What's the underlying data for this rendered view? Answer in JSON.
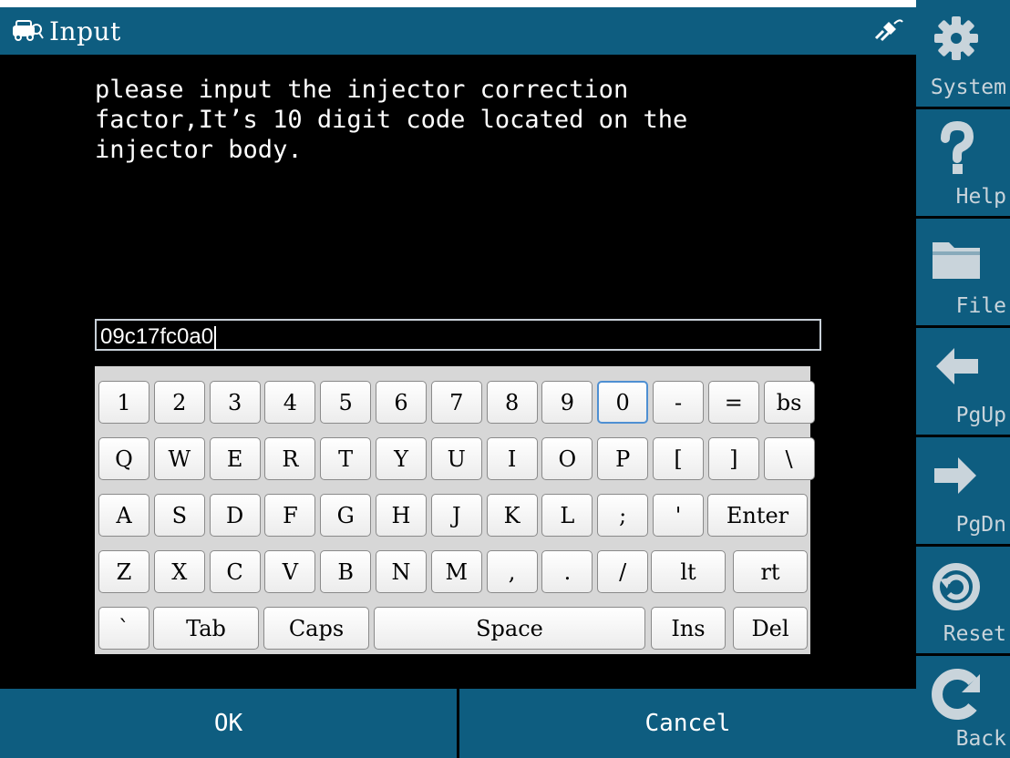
{
  "window": {
    "title": "Input",
    "car_icon": "car-icon",
    "connection_icon": "connection-icon"
  },
  "prompt": {
    "text": "please input the injector correction\nfactor,It’s 10 digit code located on the\ninjector body."
  },
  "input": {
    "value": "09c17fc0a0"
  },
  "keyboard": {
    "rows": [
      [
        "1",
        "2",
        "3",
        "4",
        "5",
        "6",
        "7",
        "8",
        "9",
        "0",
        "-",
        "=",
        "bs"
      ],
      [
        "Q",
        "W",
        "E",
        "R",
        "T",
        "Y",
        "U",
        "I",
        "O",
        "P",
        "[",
        "]",
        "\\"
      ],
      [
        "A",
        "S",
        "D",
        "F",
        "G",
        "H",
        "J",
        "K",
        "L",
        ";",
        "'",
        "Enter"
      ],
      [
        "Z",
        "X",
        "C",
        "V",
        "B",
        "N",
        "M",
        ",",
        ".",
        "/",
        "lt",
        "rt"
      ],
      [
        "`",
        "Tab",
        "Caps",
        "Space",
        "Ins",
        "Del"
      ]
    ],
    "selected_key": "0"
  },
  "buttons": {
    "ok": "OK",
    "cancel": "Cancel"
  },
  "sidebar": {
    "items": [
      {
        "label": "System",
        "icon": "gear-icon"
      },
      {
        "label": "Help",
        "icon": "question-icon"
      },
      {
        "label": "File",
        "icon": "folder-icon"
      },
      {
        "label": "PgUp",
        "icon": "arrow-left-icon"
      },
      {
        "label": "PgDn",
        "icon": "arrow-right-icon"
      },
      {
        "label": "Reset",
        "icon": "reset-icon"
      },
      {
        "label": "Back",
        "icon": "back-icon"
      }
    ]
  },
  "colors": {
    "bar": "#0e5d80",
    "key_face": "#ffffff",
    "key_selected_border": "#4e8fd2",
    "sidebar_label": "#c9d4db"
  }
}
